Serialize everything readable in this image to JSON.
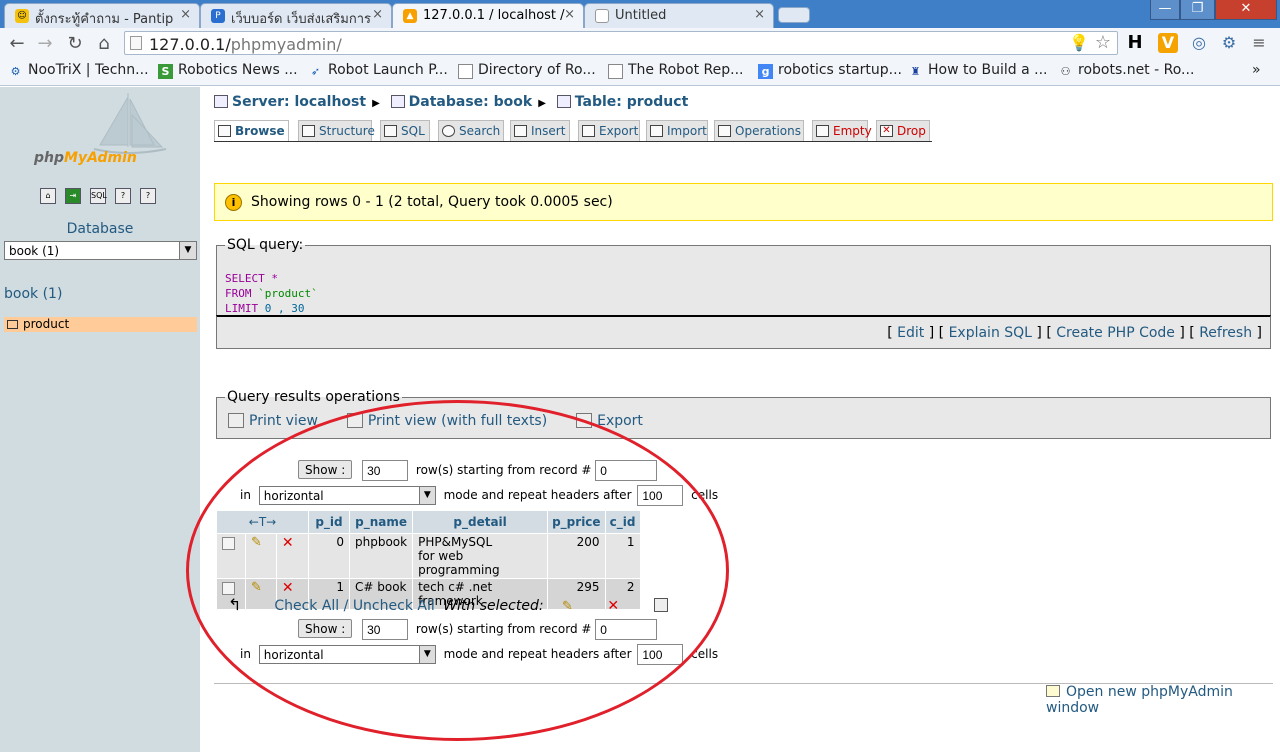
{
  "browser": {
    "tabs": [
      {
        "title": "ตั้งกระทู้คำถาม - Pantip",
        "favicon": "emoji-icon",
        "active": false
      },
      {
        "title": "เว็บบอร์ด เว็บส่งเสริมการ",
        "favicon": "page-icon",
        "active": false
      },
      {
        "title": "127.0.0.1 / localhost /",
        "favicon": "pma-icon",
        "active": true
      },
      {
        "title": "Untitled",
        "favicon": "blank-page-icon",
        "active": false
      }
    ],
    "tab_close": "×",
    "window_controls": [
      "—",
      "❐",
      "✕"
    ],
    "url_host": "127.0.0.1/",
    "url_path": "phpmyadmin/",
    "bookmarks": [
      "NooTriX | Techn...",
      "Robotics News ...",
      "Robot Launch P...",
      "Directory of Ro...",
      "The Robot Rep...",
      "robotics startup...",
      "How to Build a ...",
      "robots.net - Ro..."
    ],
    "bookmarks_more": "»"
  },
  "sidebar": {
    "logo_text_a": "php",
    "logo_text_b": "MyAdmin",
    "database_label": "Database",
    "database_select": "book (1)",
    "db_link": "book (1)",
    "table_item": "product"
  },
  "breadcrumb": {
    "server": "Server: localhost",
    "database": "Database: book",
    "table": "Table: product"
  },
  "tabs": [
    "Browse",
    "Structure",
    "SQL",
    "Search",
    "Insert",
    "Export",
    "Import",
    "Operations",
    "Empty",
    "Drop"
  ],
  "notice": "Showing rows 0 - 1 (2 total, Query took 0.0005 sec)",
  "sql_box": {
    "legend": "SQL query:",
    "select": "SELECT",
    "star": " *",
    "from": "FROM",
    "table": " `product`",
    "limit": "LIMIT",
    "limit_vals": " 0 , 30"
  },
  "sql_links": [
    "Edit",
    "Explain SQL",
    "Create PHP Code",
    "Refresh"
  ],
  "results_ops": {
    "legend": "Query results operations",
    "print_view": "Print view",
    "print_view_full": "Print view (with full texts)",
    "export": "Export"
  },
  "nav": {
    "show_button": "Show :",
    "rows_value": "30",
    "rows_label": "row(s) starting from record #",
    "start_value": "0",
    "in_label": "in",
    "mode_value": "horizontal",
    "mode_label": "mode and repeat headers after",
    "repeat_value": "100",
    "cells_label": "cells"
  },
  "table": {
    "sort_arrows": "←T→",
    "columns": [
      "p_id",
      "p_name",
      "p_detail",
      "p_price",
      "c_id"
    ],
    "rows": [
      {
        "p_id": "0",
        "p_name": "phpbook",
        "p_detail_1": "PHP&MySQL",
        "p_detail_2": "for web programming",
        "p_price": "200",
        "c_id": "1"
      },
      {
        "p_id": "1",
        "p_name": "C# book",
        "p_detail_1": "tech c# .net framework",
        "p_detail_2": "",
        "p_price": "295",
        "c_id": "2"
      }
    ]
  },
  "bulk": {
    "check_all": "Check All",
    "separator": " / ",
    "uncheck_all": "Uncheck All",
    "with_selected": "With selected:"
  },
  "footer": {
    "new_window": "Open new phpMyAdmin window"
  },
  "colors": {
    "link": "#235a81",
    "annotation": "#e0202a",
    "notice_bg": "#ffffcc"
  }
}
